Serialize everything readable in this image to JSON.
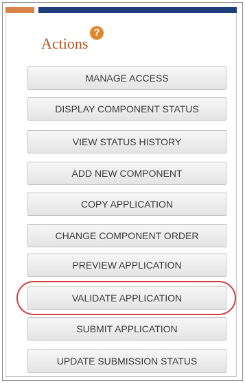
{
  "panel": {
    "title": "Actions",
    "help_icon_glyph": "?",
    "accent_colors": {
      "orange": "#d9824a",
      "navy": "#1f3f7a",
      "title": "#b4541e",
      "highlight": "#d9393f"
    }
  },
  "actions": [
    {
      "label": "MANAGE ACCESS"
    },
    {
      "label": "DISPLAY COMPONENT STATUS"
    },
    {
      "label": "VIEW STATUS HISTORY"
    },
    {
      "label": "ADD NEW COMPONENT"
    },
    {
      "label": "COPY APPLICATION"
    },
    {
      "label": "CHANGE COMPONENT ORDER"
    },
    {
      "label": "PREVIEW APPLICATION"
    },
    {
      "label": "VALIDATE APPLICATION",
      "highlighted": true
    },
    {
      "label": "SUBMIT APPLICATION"
    },
    {
      "label": "UPDATE SUBMISSION STATUS"
    }
  ]
}
